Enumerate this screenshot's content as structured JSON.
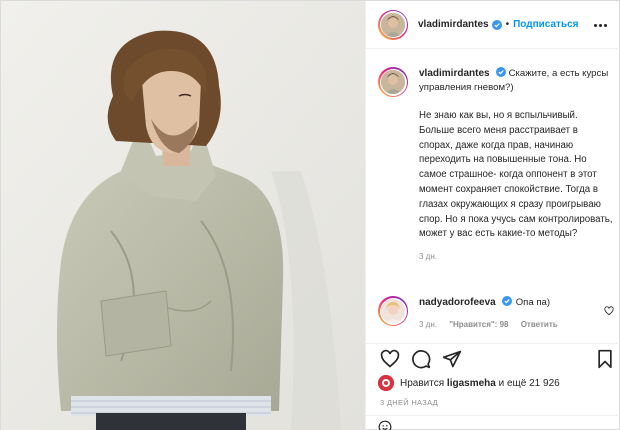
{
  "post": {
    "author": "vladimirdantes",
    "follow_label": "Подписаться",
    "separator": "•",
    "caption_lead": "Скажите, а есть курсы управления гневом?)",
    "caption_body": "Не знаю как вы, но я вспыльчивый. Больше всего меня расстраивает в спорах, даже когда прав, начинаю переходить на повышенные тона. Но самое страшное- когда оппонент в этот момент сохраняет спокойствие. Тогда в глазах окружающих я сразу проигрываю спор. Но я пока учусь сам контролировать, может у вас есть какие-то методы?",
    "caption_age": "3 дн."
  },
  "comment": {
    "author": "nadyadorofeeva",
    "text": "Опа па)",
    "age": "3 дн.",
    "likes": "\"Нравится\": 98",
    "reply_label": "Ответить"
  },
  "likes": {
    "prefix": "Нравится",
    "user": "ligasmeha",
    "suffix": "и ещё 21 926"
  },
  "timestamp": "3 ДНЕЙ НАЗАД",
  "icons": {
    "verified": "verified-badge-icon",
    "more": "more-options-icon",
    "heart": "heart-icon",
    "comment": "comment-icon",
    "share": "share-icon",
    "save": "bookmark-icon",
    "emoji": "emoji-icon"
  },
  "colors": {
    "accent": "#0095f6",
    "text": "#262626",
    "muted": "#8e8e8e",
    "border": "#efefef"
  }
}
